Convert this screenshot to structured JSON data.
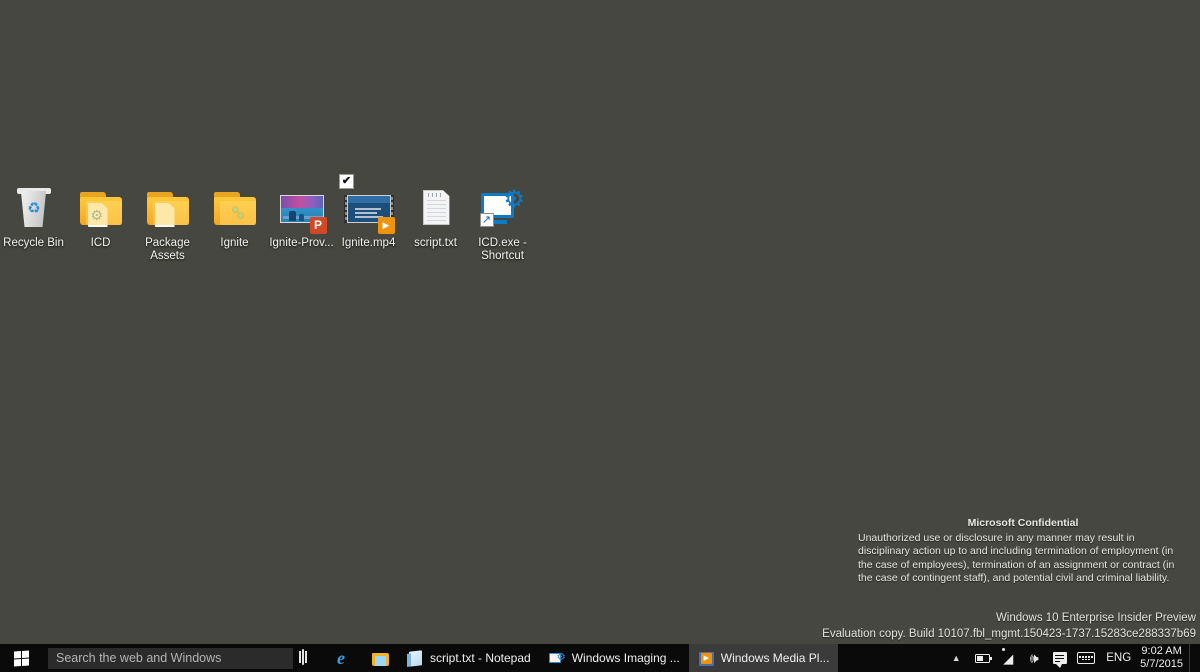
{
  "desktop": {
    "background_color": "#474741",
    "icons": [
      {
        "name": "recycle-bin",
        "label": "Recycle Bin",
        "icon": "recycle-bin-icon",
        "selected": false
      },
      {
        "name": "icd-folder",
        "label": "ICD",
        "icon": "folder-gear-icon",
        "selected": false
      },
      {
        "name": "package-assets",
        "label": "Package Assets",
        "icon": "folder-document-icon",
        "selected": false
      },
      {
        "name": "ignite-folder",
        "label": "Ignite",
        "icon": "folder-icon",
        "selected": false
      },
      {
        "name": "ignite-prov-pptx",
        "label": "Ignite-Prov...",
        "icon": "powerpoint-icon",
        "selected": false
      },
      {
        "name": "ignite-mp4",
        "label": "Ignite.mp4",
        "icon": "video-file-icon",
        "selected": true
      },
      {
        "name": "script-txt",
        "label": "script.txt",
        "icon": "text-file-icon",
        "selected": false
      },
      {
        "name": "icd-exe-shortcut",
        "label": "ICD.exe - Shortcut",
        "icon": "monitor-gear-shortcut-icon",
        "selected": false
      }
    ]
  },
  "watermark": {
    "confidential_heading": "Microsoft Confidential",
    "confidential_body": "Unauthorized use or disclosure in any manner may result in disciplinary action up to and including termination of employment (in the case of employees), termination of an assignment or contract (in the case of contingent staff), and potential civil and criminal liability.",
    "edition": "Windows 10 Enterprise Insider Preview",
    "build": "Evaluation copy. Build 10107.fbl_mgmt.150423-1737.15283ce288337b69"
  },
  "taskbar": {
    "start_label": "Start",
    "search": {
      "placeholder": "Search the web and Windows",
      "value": ""
    },
    "buttons": [
      {
        "name": "task-view-button",
        "label": "",
        "icon": "task-view-icon",
        "active": false
      },
      {
        "name": "internet-explorer",
        "label": "",
        "icon": "internet-explorer-icon",
        "active": false
      },
      {
        "name": "file-explorer",
        "label": "",
        "icon": "file-explorer-icon",
        "active": false
      },
      {
        "name": "notepad-window",
        "label": "script.txt - Notepad",
        "icon": "notepad-icon",
        "active": false
      },
      {
        "name": "windows-imaging-window",
        "label": "Windows Imaging ...",
        "icon": "windows-imaging-icon",
        "active": false
      },
      {
        "name": "windows-media-player-window",
        "label": "Windows Media Pl...",
        "icon": "windows-media-player-icon",
        "active": true
      }
    ],
    "tray": {
      "show_hidden_icons": "▲",
      "icons": [
        {
          "name": "battery-icon",
          "title": "Battery"
        },
        {
          "name": "wifi-icon",
          "title": "Network"
        },
        {
          "name": "volume-icon",
          "title": "Volume"
        },
        {
          "name": "action-center-icon",
          "title": "Action Center"
        },
        {
          "name": "touch-keyboard-icon",
          "title": "Touch keyboard"
        }
      ],
      "language": "ENG",
      "time": "9:02 AM",
      "date": "5/7/2015"
    }
  }
}
